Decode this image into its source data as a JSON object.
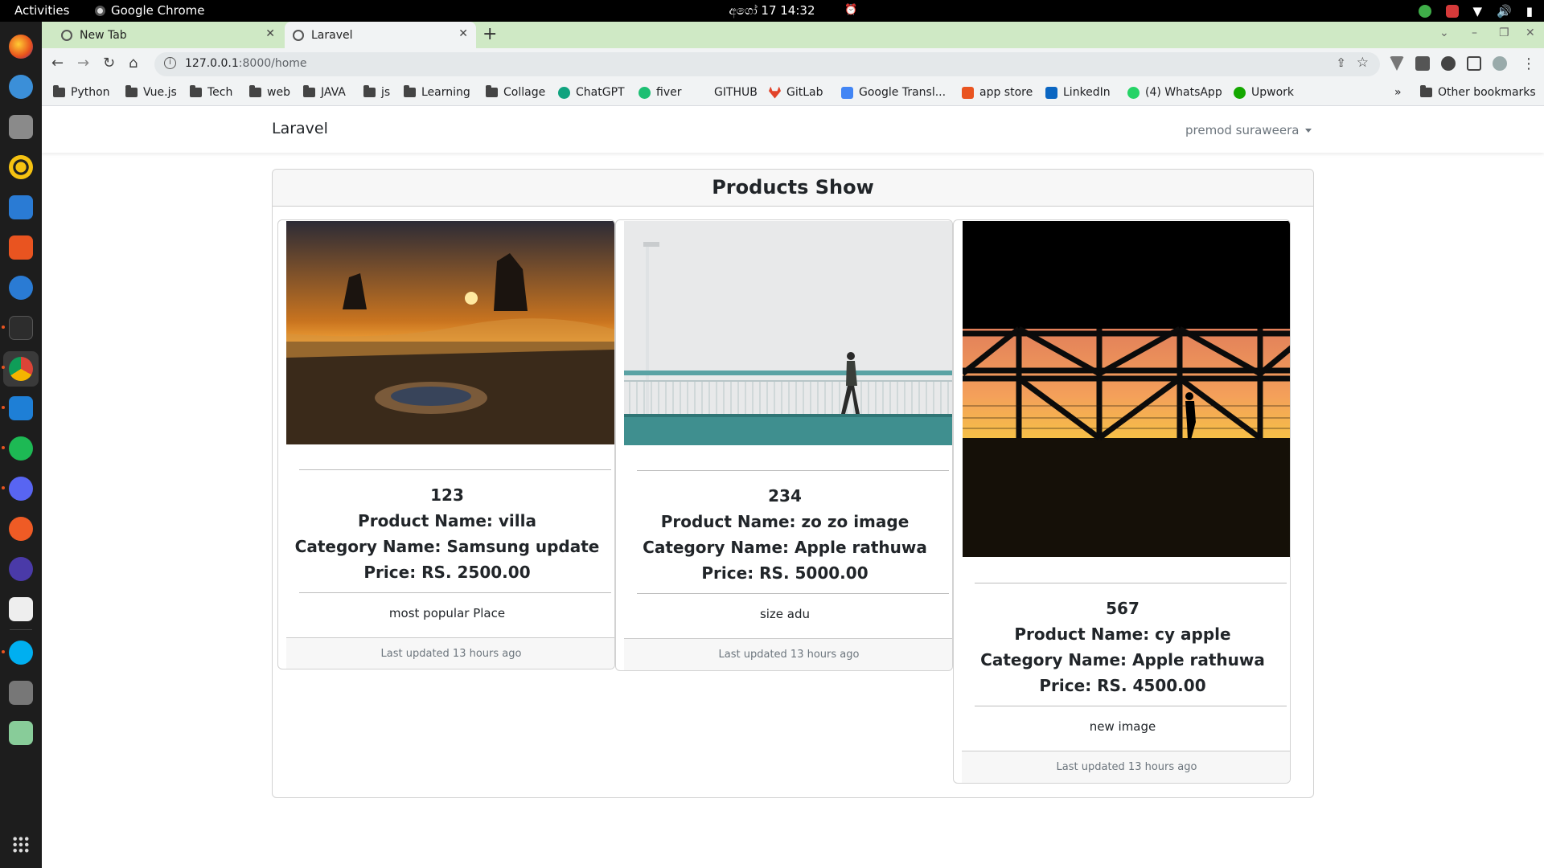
{
  "system": {
    "activities": "Activities",
    "app_name": "Google Chrome",
    "clock": "අගෝ 17  14:32"
  },
  "browser": {
    "tabs": [
      {
        "label": "New Tab",
        "active": false
      },
      {
        "label": "Laravel",
        "active": true
      }
    ],
    "url_host": "127.0.0.1",
    "url_path": ":8000/home",
    "bookmarks": [
      {
        "label": "Python",
        "icon": "folder-icon"
      },
      {
        "label": "Vue.js",
        "icon": "folder-icon"
      },
      {
        "label": "Tech",
        "icon": "folder-icon"
      },
      {
        "label": "web",
        "icon": "folder-icon"
      },
      {
        "label": "JAVA",
        "icon": "folder-icon"
      },
      {
        "label": "js",
        "icon": "folder-icon"
      },
      {
        "label": "Learning",
        "icon": "folder-icon"
      },
      {
        "label": "Collage",
        "icon": "folder-icon"
      },
      {
        "label": "ChatGPT",
        "icon": "chatgpt-icon"
      },
      {
        "label": "fiver",
        "icon": "fiverr-icon"
      },
      {
        "label": "GITHUB",
        "icon": "github-icon"
      },
      {
        "label": "GitLab",
        "icon": "gitlab-icon"
      },
      {
        "label": "Google Transl...",
        "icon": "google-translate-icon"
      },
      {
        "label": "app store",
        "icon": "app-store-icon"
      },
      {
        "label": "LinkedIn",
        "icon": "linkedin-icon"
      },
      {
        "label": "(4) WhatsApp",
        "icon": "whatsapp-icon"
      },
      {
        "label": "Upwork",
        "icon": "upwork-icon"
      }
    ],
    "bookmarks_overflow": "»",
    "other_bookmarks": "Other bookmarks"
  },
  "navbar": {
    "brand": "Laravel",
    "user": "premod suraweera"
  },
  "main": {
    "title": "Products Show",
    "products": [
      {
        "id": "123",
        "product_name": "Product Name: villa",
        "category_name": "Category Name: Samsung update",
        "price": "Price: RS. 2500.00",
        "description": "most popular Place",
        "updated": "Last updated 13 hours ago"
      },
      {
        "id": "234",
        "product_name": "Product Name: zo zo image",
        "category_name": "Category Name: Apple rathuwa",
        "price": "Price: RS. 5000.00",
        "description": "size adu",
        "updated": "Last updated 13 hours ago"
      },
      {
        "id": "567",
        "product_name": "Product Name: cy apple",
        "category_name": "Category Name: Apple rathuwa",
        "price": "Price: RS. 4500.00",
        "description": "new image",
        "updated": "Last updated 13 hours ago"
      }
    ]
  },
  "colors": {
    "tabstrip": "#cfe9c5",
    "toolbar": "#f1f3f4",
    "card_header": "#f7f7f7",
    "muted_text": "#6c757d"
  }
}
